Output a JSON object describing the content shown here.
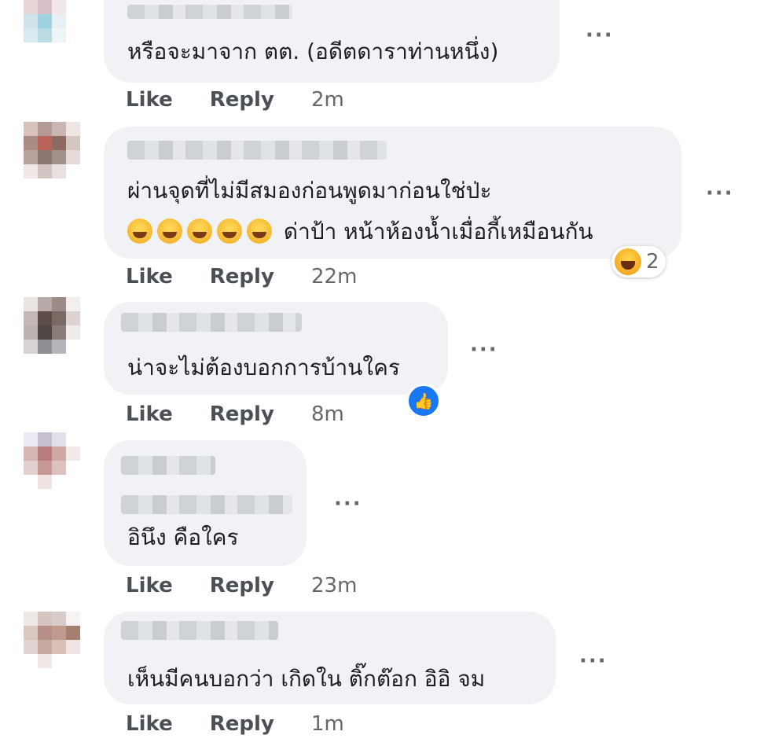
{
  "comments": [
    {
      "text": "หรือจะมาจาก ตต. (อดีตดาราท่านหนึ่ง)",
      "like": "Like",
      "reply": "Reply",
      "time": "2m"
    },
    {
      "line1": "ผ่านจุดที่ไม่มีสมองก่อนพูดมาก่อนใช่ป่ะ",
      "line2": "ด่าป้า หน้าห้องน้ำเมื่อกี้เหมือนกัน",
      "reaction_count": "2",
      "like": "Like",
      "reply": "Reply",
      "time": "22m"
    },
    {
      "text": "น่าจะไม่ต้องบอกการบ้านใคร",
      "like": "Like",
      "reply": "Reply",
      "time": "8m"
    },
    {
      "text": "อินึง คือใคร",
      "like": "Like",
      "reply": "Reply",
      "time": "23m"
    },
    {
      "text": "เห็นมีคนบอกว่า เกิดใน ติ๊กต๊อก อิอิ จม",
      "like": "Like",
      "reply": "Reply",
      "time": "1m"
    }
  ],
  "more_glyph": "···",
  "icons": {
    "more": "more-dots-icon",
    "haha": "haha-reaction-icon",
    "like": "like-reaction-icon",
    "grin": "grinning-emoji-icon"
  },
  "colors": {
    "bubble": "#f0f2f5",
    "like_blue": "#1877f2",
    "meta": "#65676b"
  }
}
